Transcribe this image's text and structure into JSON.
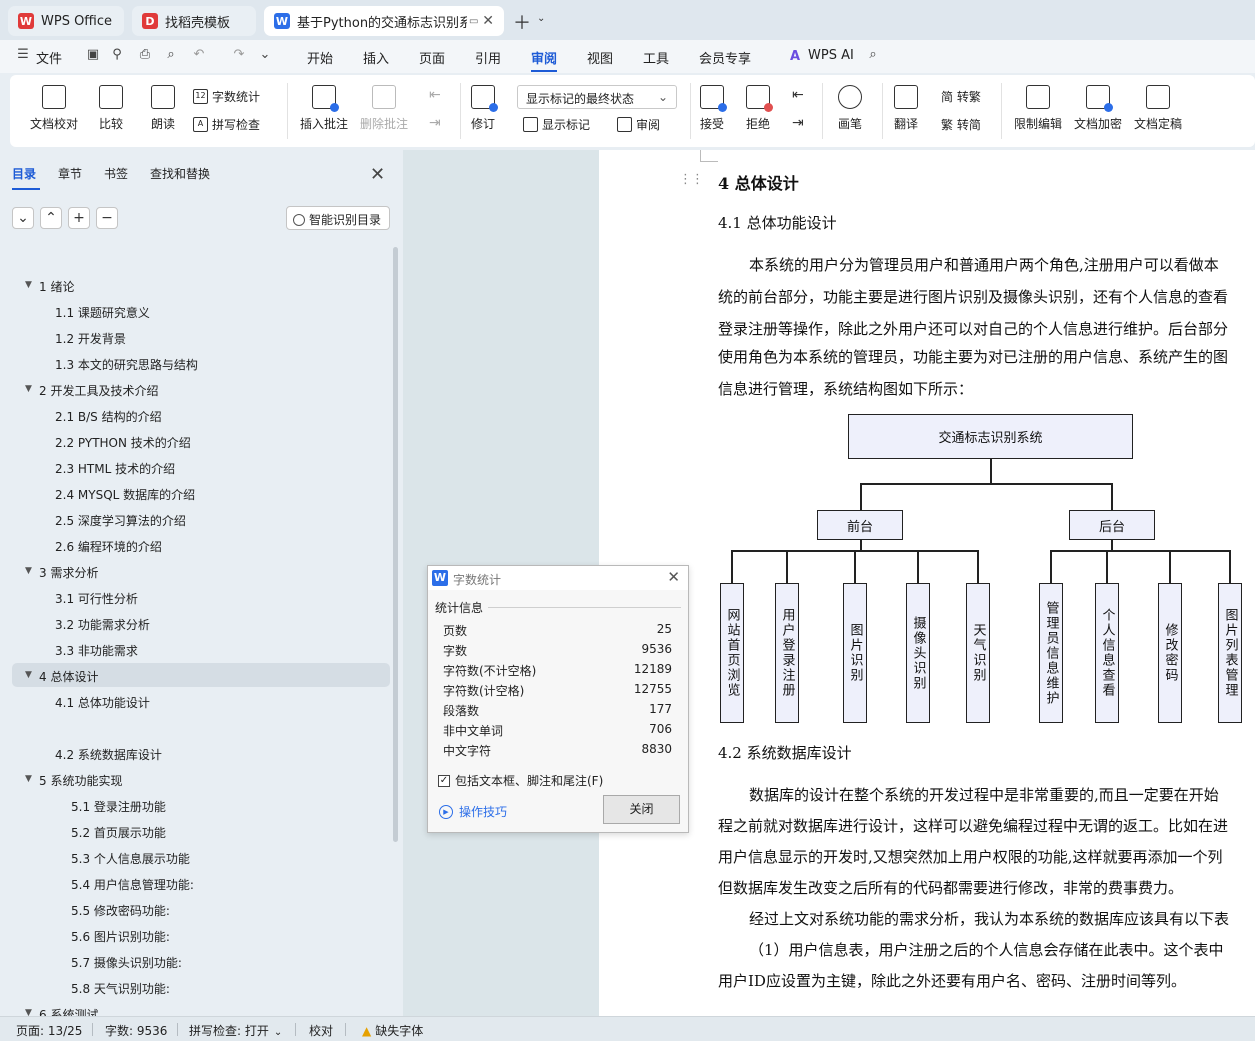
{
  "tabs": [
    {
      "label": "WPS Office",
      "icon": "wps-logo-icon"
    },
    {
      "label": "找稻壳模板",
      "icon": "docer-icon"
    },
    {
      "label": "基于Python的交通标志识别系",
      "icon": "writer-icon"
    }
  ],
  "menu": {
    "file": "文件",
    "items": [
      "开始",
      "插入",
      "页面",
      "引用",
      "审阅",
      "视图",
      "工具",
      "会员专享"
    ],
    "active": "审阅",
    "ai": "WPS AI"
  },
  "ribbon": {
    "doc_check": "文档校对",
    "compare": "比较",
    "read_aloud": "朗读",
    "word_count": "字数统计",
    "spell_check": "拼写检查",
    "insert_comment": "插入批注",
    "delete_comment": "删除批注",
    "track_changes": "修订",
    "markup_state": "显示标记的最终状态",
    "show_markup": "显示标记",
    "review_pane": "审阅",
    "accept": "接受",
    "reject": "拒绝",
    "ink": "画笔",
    "translate": "翻译",
    "to_traditional": "简 转繁",
    "to_simplified": "繁 转简",
    "restrict_edit": "限制编辑",
    "encrypt": "文档加密",
    "finalize": "文档定稿"
  },
  "nav": {
    "tabs": [
      "目录",
      "章节",
      "书签",
      "查找和替换"
    ],
    "active_tab": "目录",
    "smart_toc": "智能识别目录",
    "toc": [
      {
        "label": "1  绪论",
        "level": 1,
        "expanded": true
      },
      {
        "label": "1.1 课题研究意义",
        "level": 2
      },
      {
        "label": "1.2 开发背景",
        "level": 2
      },
      {
        "label": "1.3 本文的研究思路与结构",
        "level": 2
      },
      {
        "label": "2  开发工具及技术介绍",
        "level": 1,
        "expanded": true
      },
      {
        "label": "2.1 B/S 结构的介绍",
        "level": 2
      },
      {
        "label": "2.2 PYTHON 技术的介绍",
        "level": 2
      },
      {
        "label": "2.3 HTML 技术的介绍",
        "level": 2
      },
      {
        "label": "2.4 MYSQL 数据库的介绍",
        "level": 2
      },
      {
        "label": "2.5  深度学习算法的介绍",
        "level": 2
      },
      {
        "label": "2.6  编程环境的介绍",
        "level": 2
      },
      {
        "label": "3  需求分析",
        "level": 1,
        "expanded": true
      },
      {
        "label": "3.1  可行性分析",
        "level": 2
      },
      {
        "label": "3.2  功能需求分析",
        "level": 2
      },
      {
        "label": "3.3  非功能需求",
        "level": 2
      },
      {
        "label": "4  总体设计",
        "level": 1,
        "expanded": true,
        "selected": true
      },
      {
        "label": "4.1  总体功能设计",
        "level": 2
      },
      {
        "label": "4.2  系统数据库设计",
        "level": 2
      },
      {
        "label": "5  系统功能实现",
        "level": 1,
        "expanded": true
      },
      {
        "label": "5.1  登录注册功能",
        "level": 3
      },
      {
        "label": "5.2  首页展示功能",
        "level": 3
      },
      {
        "label": "5.3  个人信息展示功能",
        "level": 3
      },
      {
        "label": "5.4  用户信息管理功能:",
        "level": 3
      },
      {
        "label": "5.5  修改密码功能:",
        "level": 3
      },
      {
        "label": "5.6 图片识别功能:",
        "level": 3
      },
      {
        "label": "5.7 摄像头识别功能:",
        "level": 3
      },
      {
        "label": "5.8 天气识别功能:",
        "level": 3
      },
      {
        "label": "6  系统测试",
        "level": 1,
        "expanded": true
      }
    ]
  },
  "document": {
    "heading": "4 总体设计",
    "sub1": "4.1 总体功能设计",
    "para1": [
      "本系统的用户分为管理员用户和普通用户两个角色,注册用户可以看做本",
      "统的前台部分，功能主要是进行图片识别及摄像头识别，还有个人信息的查看",
      "登录注册等操作，除此之外用户还可以对自己的个人信息进行维护。后台部分",
      "使用角色为本系统的管理员，功能主要为对已注册的用户信息、系统产生的图",
      "信息进行管理，系统结构图如下所示："
    ],
    "diagram": {
      "root": "交通标志识别系统",
      "groups": [
        {
          "name": "前台",
          "children": [
            "网站首页浏览",
            "用户登录注册",
            "图片识别",
            "摄像头识别",
            "天气识别"
          ]
        },
        {
          "name": "后台",
          "children": [
            "管理员信息维护",
            "个人信息查看",
            "修改密码",
            "图片列表管理"
          ]
        }
      ]
    },
    "sub2": "4.2 系统数据库设计",
    "para2": [
      "数据库的设计在整个系统的开发过程中是非常重要的,而且一定要在开始",
      "程之前就对数据库进行设计，这样可以避免编程过程中无谓的返工。比如在进",
      "用户信息显示的开发时,又想突然加上用户权限的功能,这样就要再添加一个列",
      "但数据库发生改变之后所有的代码都需要进行修改，非常的费事费力。",
      "经过上文对系统功能的需求分析，我认为本系统的数据库应该具有以下表",
      "（1）用户信息表，用户注册之后的个人信息会存储在此表中。这个表中",
      "用户ID应设置为主键，除此之外还要有用户名、密码、注册时间等列。"
    ]
  },
  "word_count_dialog": {
    "title": "字数统计",
    "section": "统计信息",
    "stats": [
      {
        "label": "页数",
        "value": "25"
      },
      {
        "label": "字数",
        "value": "9536"
      },
      {
        "label": "字符数(不计空格)",
        "value": "12189"
      },
      {
        "label": "字符数(计空格)",
        "value": "12755"
      },
      {
        "label": "段落数",
        "value": "177"
      },
      {
        "label": "非中文单词",
        "value": "706"
      },
      {
        "label": "中文字符",
        "value": "8830"
      }
    ],
    "include_label": "包括文本框、脚注和尾注(F)",
    "include_checked": true,
    "tips": "操作技巧",
    "close": "关闭"
  },
  "status": {
    "page": "页面: 13/25",
    "words": "字数: 9536",
    "spell": "拼写检查: 打开",
    "proof": "校对",
    "missing_font": "缺失字体"
  },
  "colors": {
    "accent": "#1d5bd6",
    "wps_red": "#e03a3a"
  }
}
